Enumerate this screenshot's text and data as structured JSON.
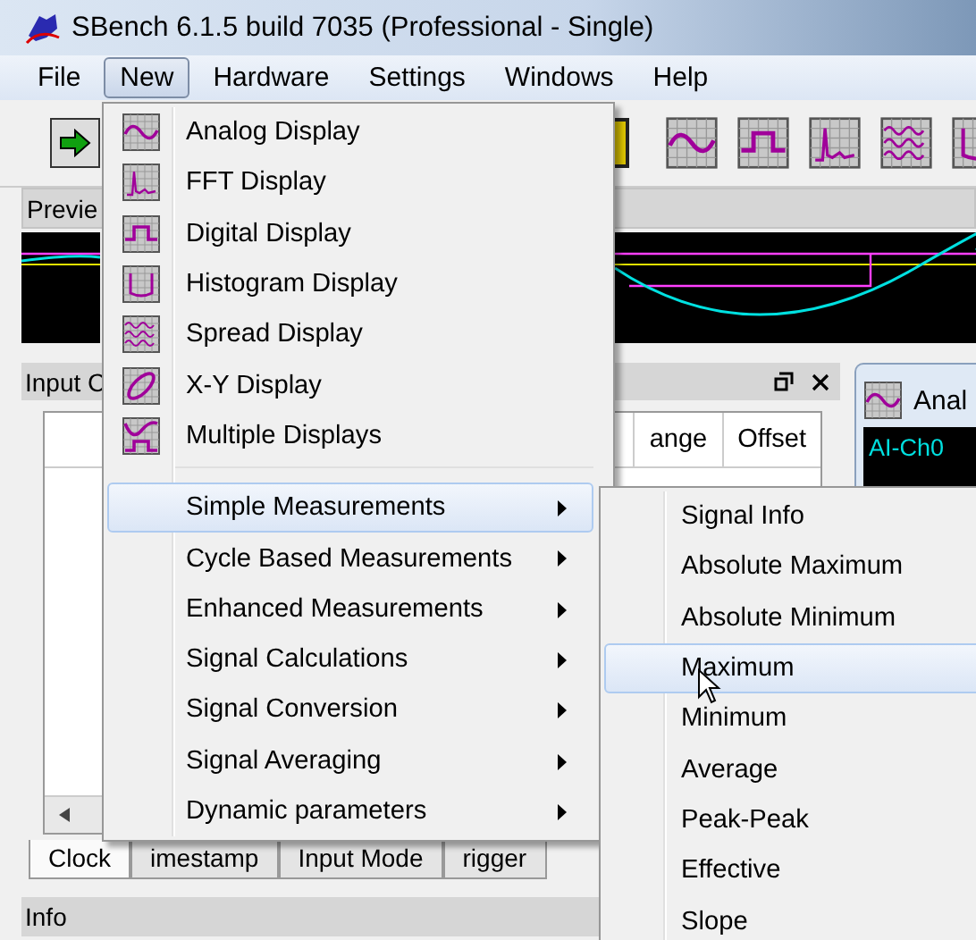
{
  "window": {
    "title": "SBench 6.1.5 build 7035 (Professional - Single)"
  },
  "menu_bar": [
    {
      "label": "File",
      "selected": false
    },
    {
      "label": "New",
      "selected": true
    },
    {
      "label": "Hardware",
      "selected": false
    },
    {
      "label": "Settings",
      "selected": false
    },
    {
      "label": "Windows",
      "selected": false
    },
    {
      "label": "Help",
      "selected": false
    }
  ],
  "preview_panel": {
    "title": "Previe"
  },
  "input_panel": {
    "title": "Input C",
    "columns": [
      "ange",
      "Offset"
    ]
  },
  "bottom_tabs": [
    {
      "label": "Clock",
      "selected": true
    },
    {
      "label": "imestamp",
      "selected": false
    },
    {
      "label": "Input Mode",
      "selected": false
    },
    {
      "label": "rigger",
      "selected": false
    }
  ],
  "info_panel": {
    "title": "Info"
  },
  "analog_panel": {
    "title": "Anal",
    "channel": "AI-Ch0"
  },
  "new_menu": {
    "items": [
      {
        "label": "Analog Display",
        "kind": "display",
        "selected": false
      },
      {
        "label": "FFT Display",
        "kind": "display",
        "selected": false
      },
      {
        "label": "Digital Display",
        "kind": "display",
        "selected": false
      },
      {
        "label": "Histogram Display",
        "kind": "display",
        "selected": false
      },
      {
        "label": "Spread Display",
        "kind": "display",
        "selected": false
      },
      {
        "label": "X-Y Display",
        "kind": "display",
        "selected": false
      },
      {
        "label": "Multiple Displays",
        "kind": "display",
        "selected": false
      },
      {
        "kind": "separator"
      },
      {
        "label": "Simple Measurements",
        "kind": "submenu",
        "selected": true
      },
      {
        "label": "Cycle Based Measurements",
        "kind": "submenu",
        "selected": false
      },
      {
        "label": "Enhanced Measurements",
        "kind": "submenu",
        "selected": false
      },
      {
        "label": "Signal Calculations",
        "kind": "submenu",
        "selected": false
      },
      {
        "label": "Signal Conversion",
        "kind": "submenu",
        "selected": false
      },
      {
        "label": "Signal Averaging",
        "kind": "submenu",
        "selected": false
      },
      {
        "label": "Dynamic parameters",
        "kind": "submenu",
        "selected": false
      }
    ]
  },
  "measurements_menu": {
    "items": [
      {
        "label": "Signal Info",
        "selected": false
      },
      {
        "label": "Absolute Maximum",
        "selected": false
      },
      {
        "label": "Absolute Minimum",
        "selected": false
      },
      {
        "label": "Maximum",
        "selected": true
      },
      {
        "label": "Minimum",
        "selected": false
      },
      {
        "label": "Average",
        "selected": false
      },
      {
        "label": "Peak-Peak",
        "selected": false
      },
      {
        "label": "Effective",
        "selected": false
      },
      {
        "label": "Slope",
        "selected": false
      }
    ]
  }
}
